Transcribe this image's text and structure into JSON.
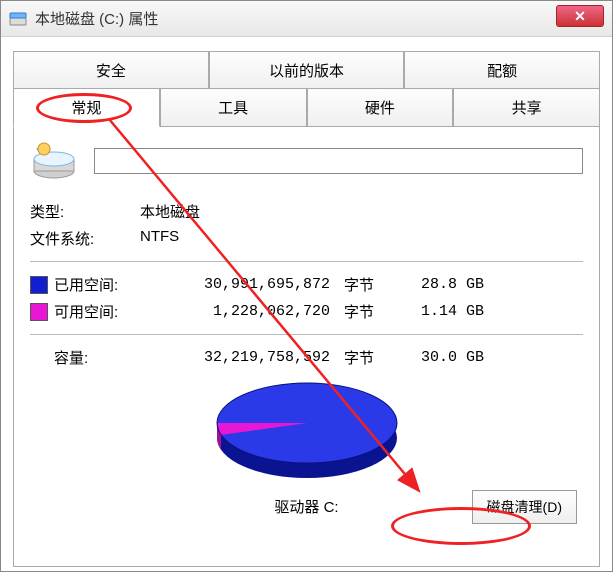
{
  "window": {
    "title": "本地磁盘 (C:) 属性"
  },
  "tabs_top": [
    {
      "label": "安全"
    },
    {
      "label": "以前的版本"
    },
    {
      "label": "配额"
    }
  ],
  "tabs_bottom": [
    {
      "label": "常规",
      "active": true
    },
    {
      "label": "工具"
    },
    {
      "label": "硬件"
    },
    {
      "label": "共享"
    }
  ],
  "drive": {
    "name_value": "",
    "type_label": "类型:",
    "type_value": "本地磁盘",
    "fs_label": "文件系统:",
    "fs_value": "NTFS"
  },
  "space": {
    "used_label": "已用空间:",
    "used_bytes": "30,991,695,872",
    "used_unit": "字节",
    "used_gb": "28.8 GB",
    "free_label": "可用空间:",
    "free_bytes": "1,228,062,720",
    "free_unit": "字节",
    "free_gb": "1.14 GB",
    "capacity_label": "容量:",
    "capacity_bytes": "32,219,758,592",
    "capacity_unit": "字节",
    "capacity_gb": "30.0 GB"
  },
  "footer": {
    "drive_label": "驱动器 C:",
    "cleanup_label": "磁盘清理(D)"
  },
  "chart_data": {
    "type": "pie",
    "title": "",
    "series": [
      {
        "name": "已用空间",
        "value": 30991695872,
        "color": "#1020d0"
      },
      {
        "name": "可用空间",
        "value": 1228062720,
        "color": "#e817d6"
      }
    ]
  }
}
